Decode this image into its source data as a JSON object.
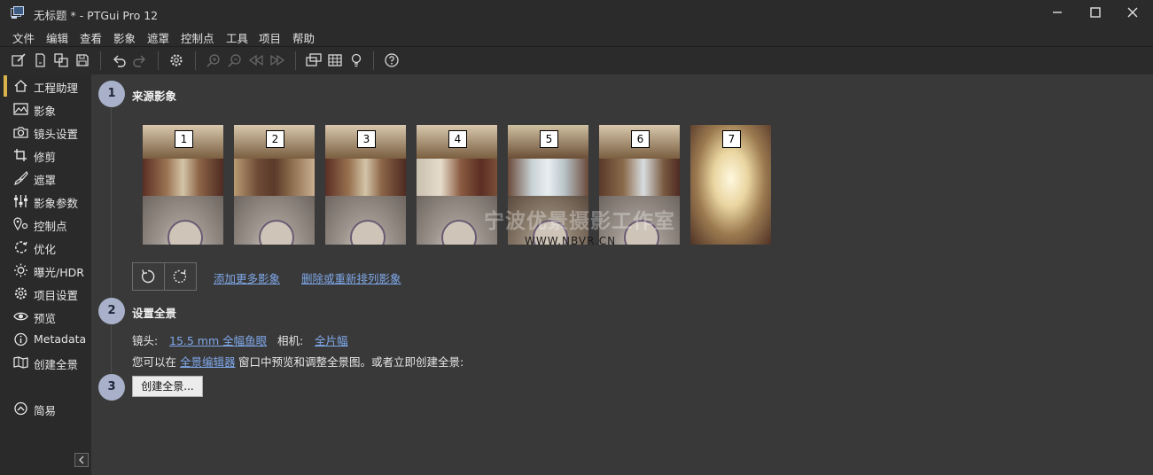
{
  "window": {
    "title": "无标题 * - PTGui Pro 12"
  },
  "menu": [
    "文件",
    "编辑",
    "查看",
    "影象",
    "遮罩",
    "控制点",
    "工具",
    "项目",
    "帮助"
  ],
  "toolbar_icons": [
    "edit-icon",
    "new-document-icon",
    "copy-icon",
    "save-icon",
    "undo-icon",
    "redo-icon",
    "settings-icon",
    "zoom-in-icon",
    "zoom-out-icon",
    "first-icon",
    "last-icon",
    "panorama-editor-icon",
    "table-icon",
    "light-bulb-icon",
    "help-icon"
  ],
  "sidebar": {
    "items": [
      {
        "label": "工程助理",
        "icon": "home-icon",
        "active": true
      },
      {
        "label": "影象",
        "icon": "image-icon"
      },
      {
        "label": "镜头设置",
        "icon": "camera-icon"
      },
      {
        "label": "修剪",
        "icon": "crop-icon"
      },
      {
        "label": "遮罩",
        "icon": "mask-brush-icon"
      },
      {
        "label": "影象参数",
        "icon": "sliders-icon"
      },
      {
        "label": "控制点",
        "icon": "control-points-icon"
      },
      {
        "label": "优化",
        "icon": "optimize-icon"
      },
      {
        "label": "曝光/HDR",
        "icon": "sun-icon"
      },
      {
        "label": "项目设置",
        "icon": "gear-icon"
      },
      {
        "label": "预览",
        "icon": "eye-icon"
      },
      {
        "label": "Metadata",
        "icon": "info-icon"
      },
      {
        "label": "创建全景",
        "icon": "map-icon"
      }
    ],
    "simple": {
      "label": "简易",
      "icon": "chevron-up-circle-icon"
    }
  },
  "step1": {
    "number": "1",
    "title": "来源影象",
    "thumbnails": [
      "1",
      "2",
      "3",
      "4",
      "5",
      "6",
      "7"
    ],
    "watermark_cn": "宁波优景摄影工作室",
    "watermark_url": "WWW.NBVR.CN",
    "add_link": "添加更多影象",
    "remove_link": "删除或重新排列影象"
  },
  "step2": {
    "number": "2",
    "title": "设置全景",
    "lens_label": "镜头:",
    "lens_value": "15.5 mm 全幅鱼眼",
    "camera_label": "相机:",
    "camera_value": "全片幅",
    "hint_before": "您可以在",
    "hint_link": "全景编辑器",
    "hint_after": "窗口中预览和调整全景图。或者立即创建全景:"
  },
  "step3": {
    "number": "3",
    "button": "创建全景..."
  },
  "colors": {
    "accent": "#d9b24a",
    "link": "#7fa7e8",
    "step_circle": "#a8b1c9",
    "panel": "#393939"
  }
}
